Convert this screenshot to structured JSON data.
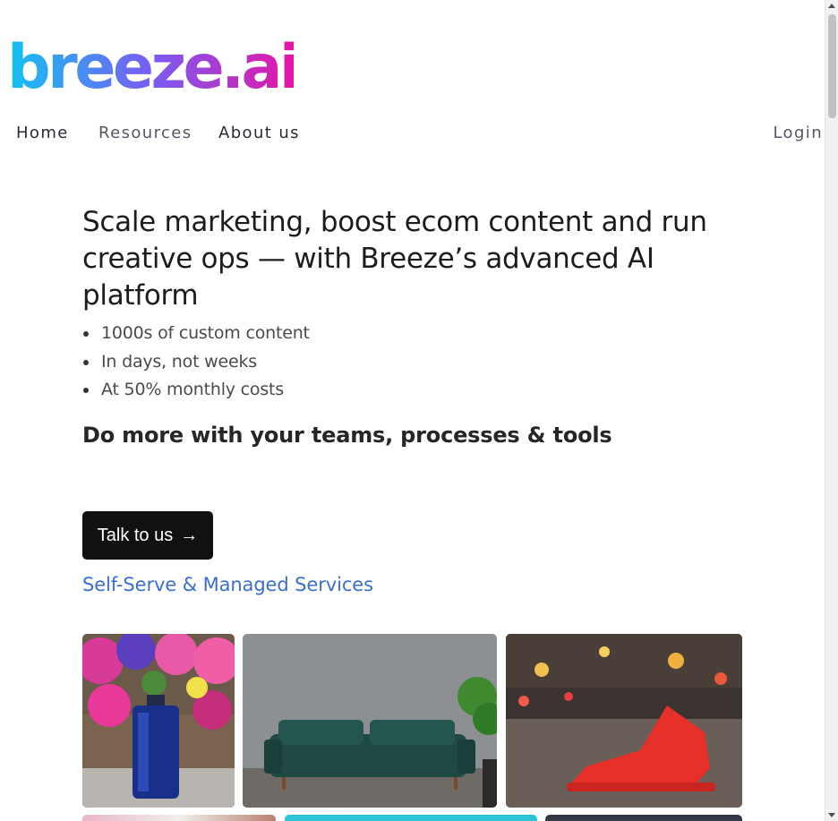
{
  "brand": {
    "logo_text": "breeze.ai",
    "gradient": [
      "#1ab8f0",
      "#7b5cf0",
      "#e21aa8"
    ]
  },
  "nav": {
    "home": "Home",
    "resources": "Resources",
    "about": "About us",
    "login": "Login"
  },
  "hero": {
    "headline": "Scale marketing, boost ecom content and run creative ops — with Breeze’s advanced AI platform",
    "bullets": [
      "1000s of custom content",
      "In days, not weeks",
      "At 50% monthly costs"
    ],
    "subhead": "Do more with your teams, processes & tools",
    "cta_label": "Talk to us",
    "cta_arrow": "→",
    "services_link": "Self-Serve & Managed Services"
  },
  "gallery": {
    "tiles": [
      {
        "name": "perfume-bottle-image",
        "icon": "image"
      },
      {
        "name": "green-sofa-image",
        "icon": "image"
      },
      {
        "name": "red-sneaker-image",
        "icon": "image"
      }
    ]
  },
  "colors": {
    "link": "#3a6fd0",
    "cta_bg": "#111111"
  }
}
